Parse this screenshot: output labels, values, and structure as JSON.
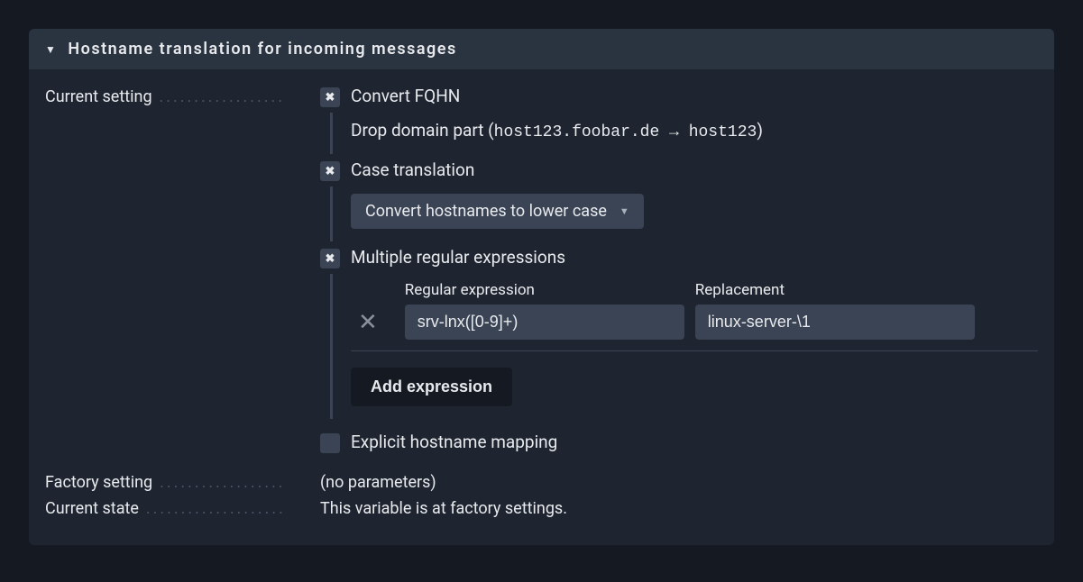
{
  "header": {
    "title": "Hostname translation for incoming messages"
  },
  "currentSetting": {
    "label": "Current setting",
    "options": {
      "fqhn": {
        "label": "Convert FQHN",
        "checked": true,
        "description_prefix": "Drop domain part (",
        "example_from": "host123.foobar.de",
        "example_arrow": " → ",
        "example_to": "host123",
        "description_suffix": ")"
      },
      "caseTranslation": {
        "label": "Case translation",
        "checked": true,
        "selected": "Convert hostnames to lower case"
      },
      "regex": {
        "label": "Multiple regular expressions",
        "checked": true,
        "fields": {
          "regex_label": "Regular expression",
          "replacement_label": "Replacement"
        },
        "expressions": [
          {
            "pattern": "srv-lnx([0-9]+)",
            "replacement": "linux-server-\\1"
          }
        ],
        "addButton": "Add expression"
      },
      "explicitMapping": {
        "label": "Explicit hostname mapping",
        "checked": false
      }
    }
  },
  "factorySetting": {
    "label": "Factory setting",
    "value": "(no parameters)"
  },
  "currentState": {
    "label": "Current state",
    "value": "This variable is at factory settings."
  }
}
